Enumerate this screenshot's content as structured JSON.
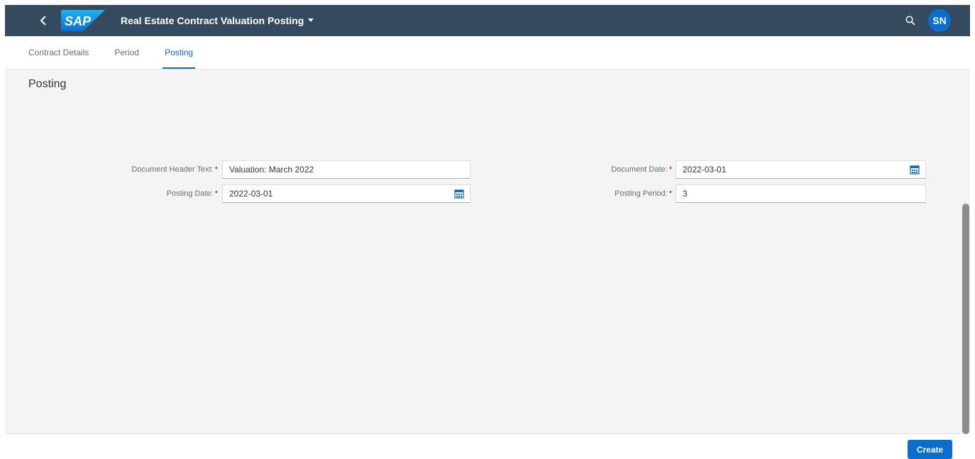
{
  "shell": {
    "app_title": "Real Estate Contract Valuation Posting",
    "logo_text": "SAP",
    "avatar_initials": "SN",
    "colors": {
      "shell": "#354a5f",
      "accent": "#0a6ed1",
      "required": "#bb0000"
    }
  },
  "tabs": [
    {
      "label": "Contract Details",
      "active": false
    },
    {
      "label": "Period",
      "active": false
    },
    {
      "label": "Posting",
      "active": true
    }
  ],
  "section": {
    "title": "Posting"
  },
  "form": {
    "document_header_text": {
      "label": "Document Header Text:",
      "required_mark": "*",
      "value": "Valuation: March 2022"
    },
    "posting_date": {
      "label": "Posting Date:",
      "required_mark": "*",
      "value": "2022-03-01"
    },
    "document_date": {
      "label": "Document Date:",
      "required_mark": "*",
      "value": "2022-03-01"
    },
    "posting_period": {
      "label": "Posting Period:",
      "required_mark": "*",
      "value": "3"
    }
  },
  "footer": {
    "create_label": "Create"
  }
}
